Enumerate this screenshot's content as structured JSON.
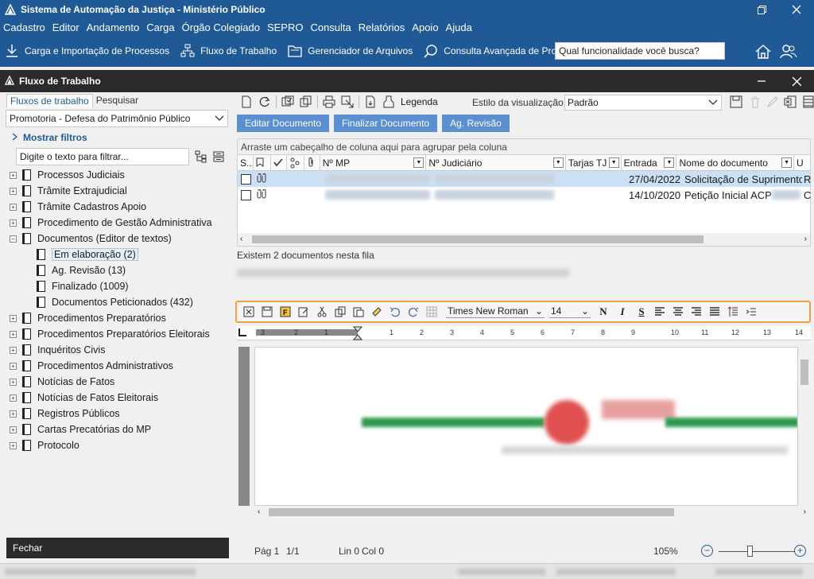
{
  "app": {
    "title": "Sistema de Automação da Justiça - Ministério Público",
    "colors": {
      "primary": "#1f5a97",
      "dark": "#2b2b2b",
      "action_button": "#5b8fcf",
      "highlight": "#f0a040",
      "selected_row": "#cce0f5"
    }
  },
  "menu": [
    "Cadastro",
    "Editor",
    "Andamento",
    "Carga",
    "Órgão Colegiado",
    "SEPRO",
    "Consulta",
    "Relatórios",
    "Apoio",
    "Ajuda"
  ],
  "quickbar": {
    "items": [
      {
        "label": "Carga e Importação de Processos",
        "icon": "download-icon"
      },
      {
        "label": "Fluxo de Trabalho",
        "icon": "workflow-icon"
      },
      {
        "label": "Gerenciador de Arquivos",
        "icon": "folder-icon"
      },
      {
        "label": "Consulta Avançada de Processos",
        "icon": "search-icon"
      }
    ],
    "search_value": "Qual funcionalidade você busca?"
  },
  "child_window": {
    "title": "Fluxo de Trabalho"
  },
  "left_panel": {
    "tabs": [
      "Fluxos de trabalho",
      "Pesquisar"
    ],
    "dropdown_value": "Promotoria - Defesa do Patrimônio Público",
    "show_filters": "Mostrar filtros",
    "filter_placeholder": "Digite o texto para filtrar...",
    "tree": [
      {
        "label": "Processos Judiciais",
        "expander": "+"
      },
      {
        "label": "Trâmite Extrajudicial",
        "expander": "+"
      },
      {
        "label": "Trâmite Cadastros Apoio",
        "expander": "+"
      },
      {
        "label": "Procedimento de Gestão Administrativa",
        "expander": "+"
      },
      {
        "label": "Documentos (Editor de textos)",
        "expander": "−"
      },
      {
        "label": "Procedimentos Preparatórios",
        "expander": "+"
      },
      {
        "label": "Procedimentos Preparatórios Eleitorais",
        "expander": "+"
      },
      {
        "label": "Inquéritos Civis",
        "expander": "+"
      },
      {
        "label": "Procedimentos Administrativos",
        "expander": "+"
      },
      {
        "label": "Notícias de Fatos",
        "expander": "+"
      },
      {
        "label": "Notícias de Fatos Eleitorais",
        "expander": "+"
      },
      {
        "label": "Registros Públicos",
        "expander": "+"
      },
      {
        "label": "Cartas Precatórias do MP",
        "expander": "+"
      },
      {
        "label": "Protocolo",
        "expander": "+"
      }
    ],
    "tree_children": [
      {
        "label": "Em elaboração (2)"
      },
      {
        "label": "Ag. Revisão (13)"
      },
      {
        "label": "Finalizado (1009)"
      },
      {
        "label": "Documentos Peticionados (432)"
      }
    ],
    "close_label": "Fechar"
  },
  "toolbar": {
    "legend_label": "Legenda",
    "style_label": "Estilo da visualização",
    "style_value": "Padrão"
  },
  "actions": [
    "Editar Documento",
    "Finalizar Documento",
    "Ag. Revisão"
  ],
  "grid": {
    "group_hint": "Arraste um cabeçalho de coluna aqui para agrupar pela coluna",
    "columns": [
      "S...",
      "Nº MP",
      "Nº Judiciário",
      "Tarjas TJ",
      "Entrada",
      "Nome do documento",
      "U"
    ],
    "rows": [
      {
        "entrada": "27/04/2022",
        "nome": "Solicitação de Suprimento",
        "extra": "R"
      },
      {
        "entrada": "14/10/2020",
        "nome": "Petição Inicial ACP",
        "extra": "C"
      }
    ]
  },
  "doc_count_text": "Existem 2 documentos nesta fila",
  "editor": {
    "font": "Times New Roman",
    "size": "14",
    "ruler_labels": [
      "3",
      "2",
      "1",
      "1",
      "1",
      "2",
      "3",
      "4",
      "5",
      "6",
      "7",
      "8",
      "9",
      "10",
      "11",
      "12",
      "13",
      "14"
    ]
  },
  "status": {
    "page": "Pág 1",
    "pages": "1/1",
    "line": "Lin 0",
    "col": "Col 0",
    "zoom": "105%"
  }
}
